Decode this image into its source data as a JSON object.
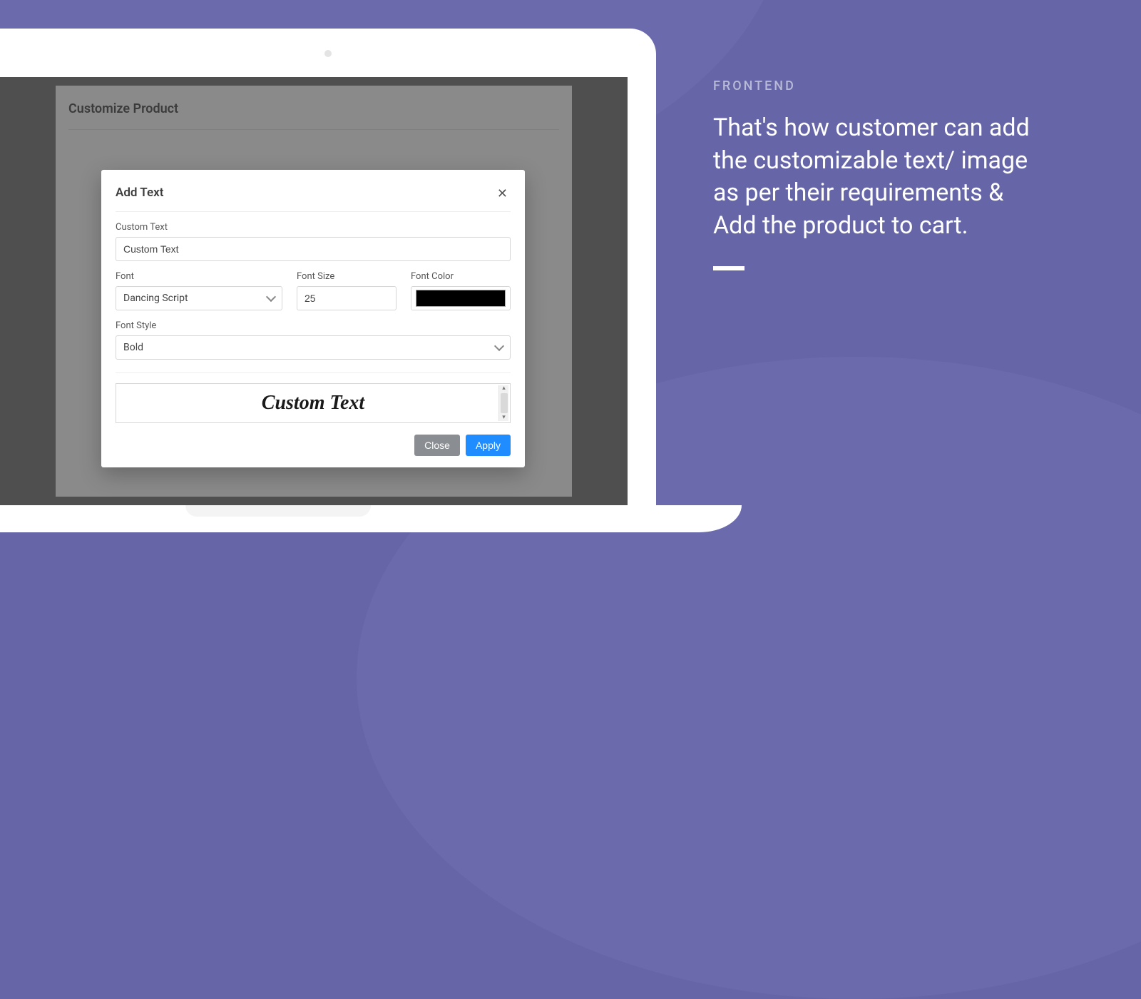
{
  "page": {
    "title": "Customize Product"
  },
  "modal": {
    "title": "Add Text",
    "fields": {
      "custom_text_label": "Custom Text",
      "custom_text_value": "Custom Text",
      "font_label": "Font",
      "font_value": "Dancing Script",
      "font_size_label": "Font Size",
      "font_size_value": "25",
      "font_color_label": "Font Color",
      "font_color_value": "#000000",
      "font_style_label": "Font Style",
      "font_style_value": "Bold"
    },
    "preview": "Custom Text",
    "buttons": {
      "close": "Close",
      "apply": "Apply"
    }
  },
  "marketing": {
    "eyebrow": "FRONTEND",
    "body": "That's how customer can add the customizable text/ image as per their requirements & Add the product to cart."
  }
}
